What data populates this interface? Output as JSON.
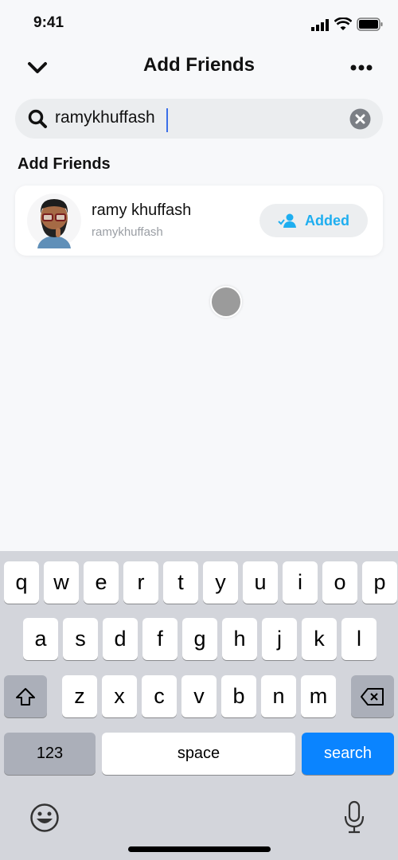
{
  "status": {
    "time": "9:41"
  },
  "header": {
    "title": "Add Friends",
    "back_icon": "chevron-down-icon",
    "more_icon": "more-horizontal-icon"
  },
  "search": {
    "value": "ramykhuffash",
    "clear_icon": "clear-circle-icon"
  },
  "section_title": "Add Friends",
  "results": [
    {
      "display_name": "ramy khuffash",
      "username": "ramykhuffash",
      "button_label": "Added"
    }
  ],
  "colors": {
    "accent": "#1eaef0",
    "search_key": "#0a84ff"
  },
  "keyboard": {
    "row1": [
      "q",
      "w",
      "e",
      "r",
      "t",
      "y",
      "u",
      "i",
      "o",
      "p"
    ],
    "row2": [
      "a",
      "s",
      "d",
      "f",
      "g",
      "h",
      "j",
      "k",
      "l"
    ],
    "row3": [
      "z",
      "x",
      "c",
      "v",
      "b",
      "n",
      "m"
    ],
    "numbers": "123",
    "space": "space",
    "search": "search"
  }
}
